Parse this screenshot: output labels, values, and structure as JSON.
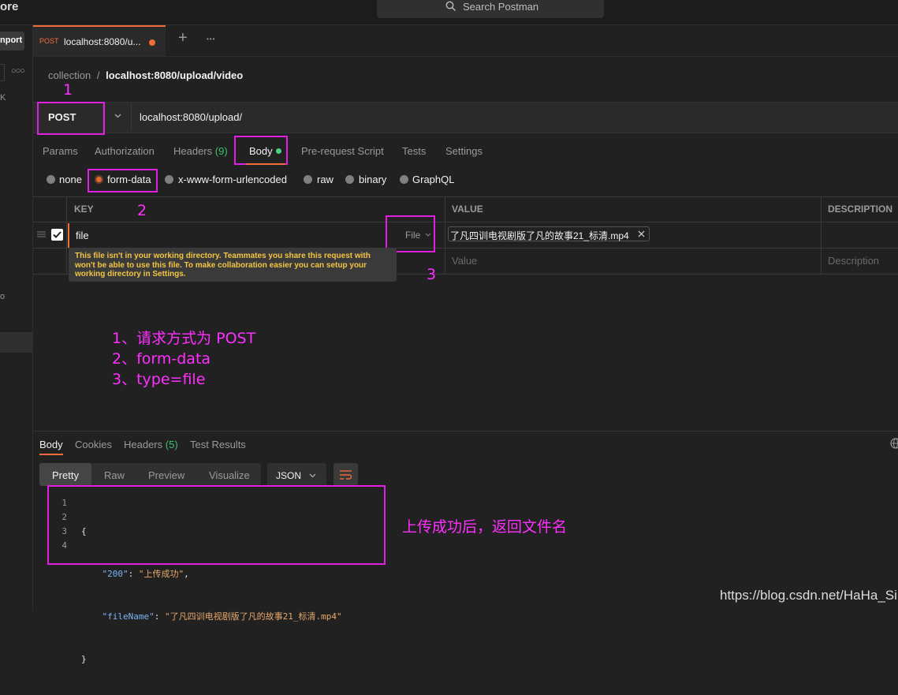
{
  "app": {
    "brand_fragment": "ore",
    "search_placeholder": "Search Postman",
    "import_label": "nport"
  },
  "tab": {
    "method": "POST",
    "title": "localhost:8080/u...",
    "new_tab": "+",
    "more": "•••"
  },
  "breadcrumb": {
    "parent": "collection",
    "separator": "/",
    "current": "localhost:8080/upload/video"
  },
  "request": {
    "method": "POST",
    "url": "localhost:8080/upload/"
  },
  "request_tabs": {
    "params": "Params",
    "authorization": "Authorization",
    "headers": "Headers",
    "headers_count": "(9)",
    "body": "Body",
    "prerequest": "Pre-request Script",
    "tests": "Tests",
    "settings": "Settings"
  },
  "body_types": {
    "none": "none",
    "form_data": "form-data",
    "urlencoded": "x-www-form-urlencoded",
    "raw": "raw",
    "binary": "binary",
    "graphql": "GraphQL"
  },
  "table": {
    "col_key": "KEY",
    "col_value": "VALUE",
    "col_description": "DESCRIPTION",
    "row_key": "file",
    "row_type": "File",
    "row_value": "了凡四训电视剧版了凡的故事21_标清.mp4",
    "value_placeholder": "Value",
    "description_placeholder": "Description"
  },
  "tooltip": {
    "text": "This file isn't in your working directory. Teammates you share this request with won't be able to use this file. To make collaboration easier you can setup your working directory in Settings."
  },
  "annotations": {
    "num1": "1",
    "num2": "2",
    "num3": "3",
    "line1": "1、请求方式为 POST",
    "line2": "2、form-data",
    "line3": "3、type=file",
    "response_note": "上传成功后，返回文件名"
  },
  "response_tabs": {
    "body": "Body",
    "cookies": "Cookies",
    "headers": "Headers",
    "headers_count": "(5)",
    "test_results": "Test Results"
  },
  "response_view": {
    "pretty": "Pretty",
    "raw": "Raw",
    "preview": "Preview",
    "visualize": "Visualize",
    "format": "JSON"
  },
  "response_code": {
    "line_numbers": [
      "1",
      "2",
      "3",
      "4"
    ],
    "open": "{",
    "k1": "\"200\"",
    "v1": "\"上传成功\"",
    "k2": "\"fileName\"",
    "v2": "\"了凡四训电视剧版了凡的故事21_标清.mp4\"",
    "close": "}"
  },
  "watermark": "https://blog.csdn.net/HaHa_Sir",
  "colors": {
    "accent_orange": "#f26b3a",
    "annotation_magenta": "#ff30ff",
    "headers_count_green": "#3fbf6f",
    "body_dot_green": "#49d37a",
    "json_key_blue": "#7ab4f5",
    "json_string_orange": "#e8a86b"
  }
}
